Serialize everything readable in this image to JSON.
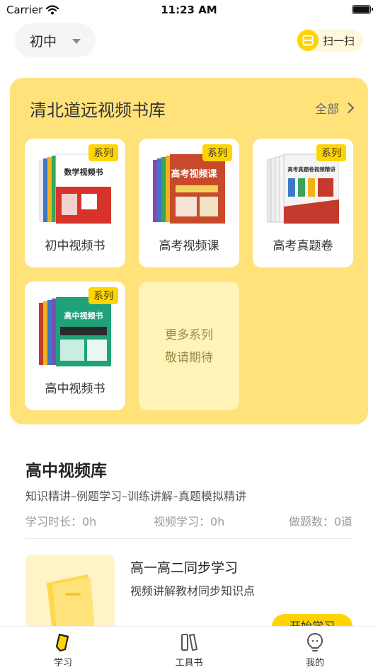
{
  "status_bar": {
    "carrier": "Carrier",
    "time": "11:23 AM"
  },
  "header": {
    "level": "初中",
    "scan_label": "扫一扫"
  },
  "library": {
    "title": "清北道远视频书库",
    "all_label": "全部",
    "series": [
      {
        "name": "初中视频书",
        "tag": "系列",
        "cover_title": "数学视频书",
        "cover_color": "#d8332b"
      },
      {
        "name": "高考视频课",
        "tag": "系列",
        "cover_title": "高考视频课",
        "cover_color": "#c94a2a"
      },
      {
        "name": "高考真题卷",
        "tag": "系列",
        "cover_title": "高考真题卷视频精讲",
        "cover_color": "#f4f4f4"
      },
      {
        "name": "高中视频书",
        "tag": "系列",
        "cover_title": "高中视频书",
        "cover_color": "#1fa27a"
      }
    ],
    "more": {
      "line1": "更多系列",
      "line2": "敬请期待"
    }
  },
  "video_library": {
    "title": "高中视频库",
    "subtitle": "知识精讲–例题学习–训练讲解–真题模拟精讲",
    "stats": {
      "study_time": "学习时长：0h",
      "video_study": "视频学习：0h",
      "questions": "做题数：0道"
    }
  },
  "course": {
    "title": "高一高二同步学习",
    "description": "视频讲解教材同步知识点",
    "button": "开始学习"
  },
  "tabs": [
    {
      "label": "学习",
      "icon": "pencil-tag-icon",
      "active": true
    },
    {
      "label": "工具书",
      "icon": "book-icon",
      "active": false
    },
    {
      "label": "我的",
      "icon": "profile-icon",
      "active": false
    }
  ],
  "colors": {
    "accent": "#ffd400",
    "card_bg": "#ffe27a",
    "more_tile_bg": "#fff3b8"
  }
}
